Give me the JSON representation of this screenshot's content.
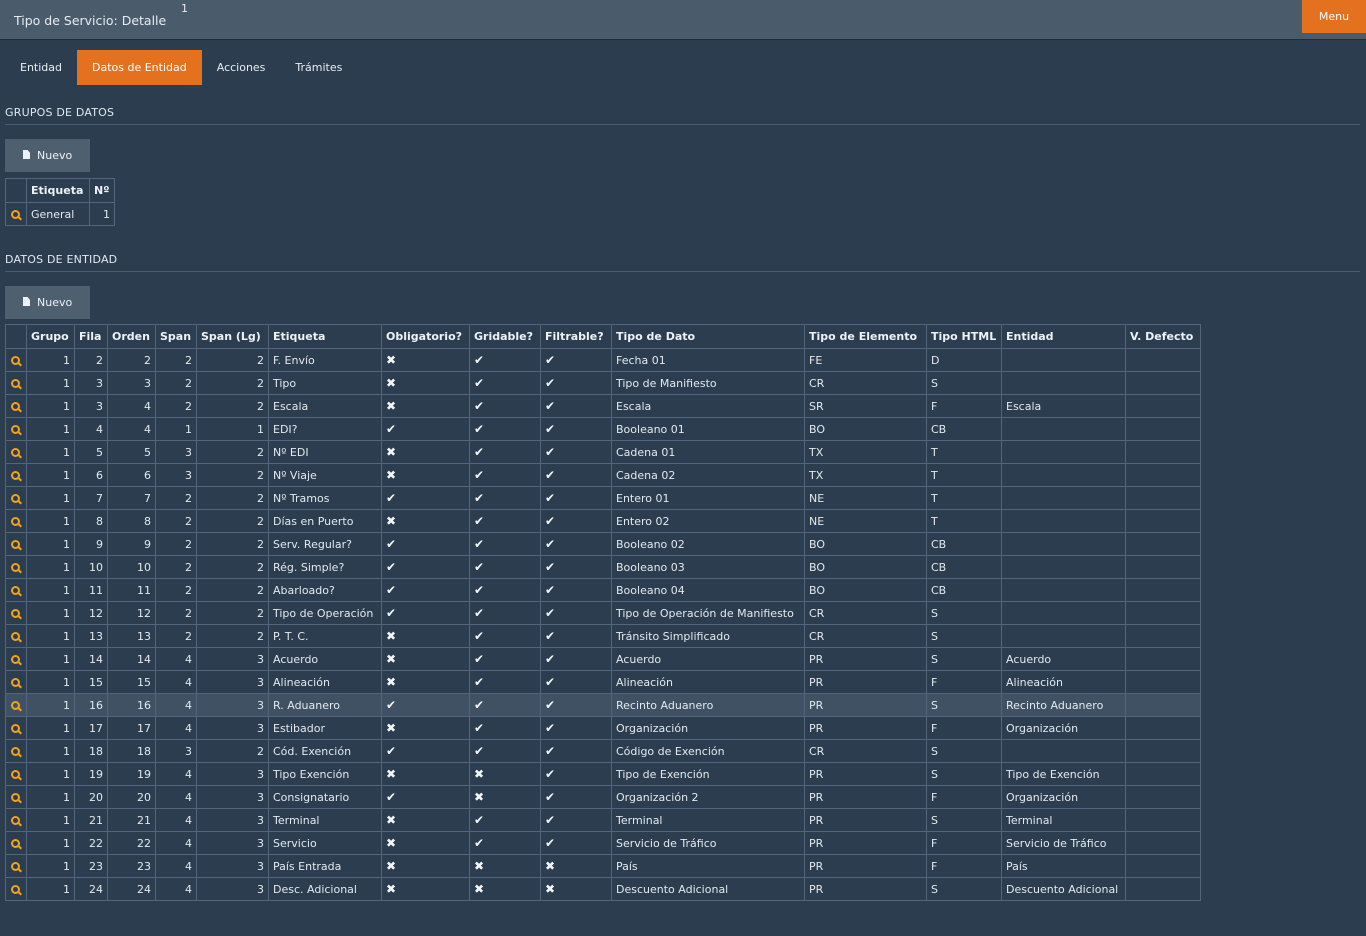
{
  "header": {
    "title": "Tipo de Servicio: Detalle",
    "counter": "1",
    "menu_label": "Menu"
  },
  "tabs": [
    {
      "label": "Entidad",
      "active": false
    },
    {
      "label": "Datos de Entidad",
      "active": true
    },
    {
      "label": "Acciones",
      "active": false
    },
    {
      "label": "Trámites",
      "active": false
    }
  ],
  "grupos": {
    "title": "GRUPOS DE DATOS",
    "new_label": "Nuevo",
    "columns": [
      "Etiqueta",
      "Nº"
    ],
    "rows": [
      {
        "etiqueta": "General",
        "n": "1"
      }
    ]
  },
  "datos": {
    "title": "DATOS DE ENTIDAD",
    "new_label": "Nuevo",
    "highlighted_row": 15,
    "columns": [
      "Grupo",
      "Fila",
      "Orden",
      "Span",
      "Span (Lg)",
      "Etiqueta",
      "Obligatorio?",
      "Gridable?",
      "Filtrable?",
      "Tipo de Dato",
      "Tipo de Elemento",
      "Tipo HTML",
      "Entidad",
      "V. Defecto"
    ],
    "rows": [
      {
        "grupo": "1",
        "fila": "2",
        "orden": "2",
        "span": "2",
        "span_lg": "2",
        "etiqueta": "F. Envío",
        "obligatorio": false,
        "gridable": true,
        "filtrable": true,
        "tipo_dato": "Fecha 01",
        "tipo_elemento": "FE",
        "tipo_html": "D",
        "entidad": "",
        "v_defecto": ""
      },
      {
        "grupo": "1",
        "fila": "3",
        "orden": "3",
        "span": "2",
        "span_lg": "2",
        "etiqueta": "Tipo",
        "obligatorio": false,
        "gridable": true,
        "filtrable": true,
        "tipo_dato": "Tipo de Manifiesto",
        "tipo_elemento": "CR",
        "tipo_html": "S",
        "entidad": "",
        "v_defecto": ""
      },
      {
        "grupo": "1",
        "fila": "3",
        "orden": "4",
        "span": "2",
        "span_lg": "2",
        "etiqueta": "Escala",
        "obligatorio": false,
        "gridable": true,
        "filtrable": true,
        "tipo_dato": "Escala",
        "tipo_elemento": "SR",
        "tipo_html": "F",
        "entidad": "Escala",
        "v_defecto": ""
      },
      {
        "grupo": "1",
        "fila": "4",
        "orden": "4",
        "span": "1",
        "span_lg": "1",
        "etiqueta": "EDI?",
        "obligatorio": true,
        "gridable": true,
        "filtrable": true,
        "tipo_dato": "Booleano 01",
        "tipo_elemento": "BO",
        "tipo_html": "CB",
        "entidad": "",
        "v_defecto": ""
      },
      {
        "grupo": "1",
        "fila": "5",
        "orden": "5",
        "span": "3",
        "span_lg": "2",
        "etiqueta": "Nº EDI",
        "obligatorio": false,
        "gridable": true,
        "filtrable": true,
        "tipo_dato": "Cadena 01",
        "tipo_elemento": "TX",
        "tipo_html": "T",
        "entidad": "",
        "v_defecto": ""
      },
      {
        "grupo": "1",
        "fila": "6",
        "orden": "6",
        "span": "3",
        "span_lg": "2",
        "etiqueta": "Nº Viaje",
        "obligatorio": false,
        "gridable": true,
        "filtrable": true,
        "tipo_dato": "Cadena 02",
        "tipo_elemento": "TX",
        "tipo_html": "T",
        "entidad": "",
        "v_defecto": ""
      },
      {
        "grupo": "1",
        "fila": "7",
        "orden": "7",
        "span": "2",
        "span_lg": "2",
        "etiqueta": "Nº Tramos",
        "obligatorio": true,
        "gridable": true,
        "filtrable": true,
        "tipo_dato": "Entero 01",
        "tipo_elemento": "NE",
        "tipo_html": "T",
        "entidad": "",
        "v_defecto": ""
      },
      {
        "grupo": "1",
        "fila": "8",
        "orden": "8",
        "span": "2",
        "span_lg": "2",
        "etiqueta": "Días en Puerto",
        "obligatorio": false,
        "gridable": true,
        "filtrable": true,
        "tipo_dato": "Entero 02",
        "tipo_elemento": "NE",
        "tipo_html": "T",
        "entidad": "",
        "v_defecto": ""
      },
      {
        "grupo": "1",
        "fila": "9",
        "orden": "9",
        "span": "2",
        "span_lg": "2",
        "etiqueta": "Serv. Regular?",
        "obligatorio": true,
        "gridable": true,
        "filtrable": true,
        "tipo_dato": "Booleano 02",
        "tipo_elemento": "BO",
        "tipo_html": "CB",
        "entidad": "",
        "v_defecto": ""
      },
      {
        "grupo": "1",
        "fila": "10",
        "orden": "10",
        "span": "2",
        "span_lg": "2",
        "etiqueta": "Rég. Simple?",
        "obligatorio": true,
        "gridable": true,
        "filtrable": true,
        "tipo_dato": "Booleano 03",
        "tipo_elemento": "BO",
        "tipo_html": "CB",
        "entidad": "",
        "v_defecto": ""
      },
      {
        "grupo": "1",
        "fila": "11",
        "orden": "11",
        "span": "2",
        "span_lg": "2",
        "etiqueta": "Abarloado?",
        "obligatorio": true,
        "gridable": true,
        "filtrable": true,
        "tipo_dato": "Booleano 04",
        "tipo_elemento": "BO",
        "tipo_html": "CB",
        "entidad": "",
        "v_defecto": ""
      },
      {
        "grupo": "1",
        "fila": "12",
        "orden": "12",
        "span": "2",
        "span_lg": "2",
        "etiqueta": "Tipo de Operación",
        "obligatorio": true,
        "gridable": true,
        "filtrable": true,
        "tipo_dato": "Tipo de Operación de Manifiesto",
        "tipo_elemento": "CR",
        "tipo_html": "S",
        "entidad": "",
        "v_defecto": ""
      },
      {
        "grupo": "1",
        "fila": "13",
        "orden": "13",
        "span": "2",
        "span_lg": "2",
        "etiqueta": "P. T. C.",
        "obligatorio": false,
        "gridable": true,
        "filtrable": true,
        "tipo_dato": "Tránsito Simplificado",
        "tipo_elemento": "CR",
        "tipo_html": "S",
        "entidad": "",
        "v_defecto": ""
      },
      {
        "grupo": "1",
        "fila": "14",
        "orden": "14",
        "span": "4",
        "span_lg": "3",
        "etiqueta": "Acuerdo",
        "obligatorio": false,
        "gridable": true,
        "filtrable": true,
        "tipo_dato": "Acuerdo",
        "tipo_elemento": "PR",
        "tipo_html": "S",
        "entidad": "Acuerdo",
        "v_defecto": ""
      },
      {
        "grupo": "1",
        "fila": "15",
        "orden": "15",
        "span": "4",
        "span_lg": "3",
        "etiqueta": "Alineación",
        "obligatorio": false,
        "gridable": true,
        "filtrable": true,
        "tipo_dato": "Alineación",
        "tipo_elemento": "PR",
        "tipo_html": "F",
        "entidad": "Alineación",
        "v_defecto": ""
      },
      {
        "grupo": "1",
        "fila": "16",
        "orden": "16",
        "span": "4",
        "span_lg": "3",
        "etiqueta": "R. Aduanero",
        "obligatorio": true,
        "gridable": true,
        "filtrable": true,
        "tipo_dato": "Recinto Aduanero",
        "tipo_elemento": "PR",
        "tipo_html": "S",
        "entidad": "Recinto Aduanero",
        "v_defecto": ""
      },
      {
        "grupo": "1",
        "fila": "17",
        "orden": "17",
        "span": "4",
        "span_lg": "3",
        "etiqueta": "Estibador",
        "obligatorio": false,
        "gridable": true,
        "filtrable": true,
        "tipo_dato": "Organización",
        "tipo_elemento": "PR",
        "tipo_html": "F",
        "entidad": "Organización",
        "v_defecto": ""
      },
      {
        "grupo": "1",
        "fila": "18",
        "orden": "18",
        "span": "3",
        "span_lg": "2",
        "etiqueta": "Cód. Exención",
        "obligatorio": true,
        "gridable": true,
        "filtrable": true,
        "tipo_dato": "Código de Exención",
        "tipo_elemento": "CR",
        "tipo_html": "S",
        "entidad": "",
        "v_defecto": ""
      },
      {
        "grupo": "1",
        "fila": "19",
        "orden": "19",
        "span": "4",
        "span_lg": "3",
        "etiqueta": "Tipo Exención",
        "obligatorio": false,
        "gridable": false,
        "filtrable": true,
        "tipo_dato": "Tipo de Exención",
        "tipo_elemento": "PR",
        "tipo_html": "S",
        "entidad": "Tipo de Exención",
        "v_defecto": ""
      },
      {
        "grupo": "1",
        "fila": "20",
        "orden": "20",
        "span": "4",
        "span_lg": "3",
        "etiqueta": "Consignatario",
        "obligatorio": true,
        "gridable": false,
        "filtrable": true,
        "tipo_dato": "Organización 2",
        "tipo_elemento": "PR",
        "tipo_html": "F",
        "entidad": "Organización",
        "v_defecto": ""
      },
      {
        "grupo": "1",
        "fila": "21",
        "orden": "21",
        "span": "4",
        "span_lg": "3",
        "etiqueta": "Terminal",
        "obligatorio": false,
        "gridable": true,
        "filtrable": true,
        "tipo_dato": "Terminal",
        "tipo_elemento": "PR",
        "tipo_html": "S",
        "entidad": "Terminal",
        "v_defecto": ""
      },
      {
        "grupo": "1",
        "fila": "22",
        "orden": "22",
        "span": "4",
        "span_lg": "3",
        "etiqueta": "Servicio",
        "obligatorio": false,
        "gridable": true,
        "filtrable": true,
        "tipo_dato": "Servicio de Tráfico",
        "tipo_elemento": "PR",
        "tipo_html": "F",
        "entidad": "Servicio de Tráfico",
        "v_defecto": ""
      },
      {
        "grupo": "1",
        "fila": "23",
        "orden": "23",
        "span": "4",
        "span_lg": "3",
        "etiqueta": "País Entrada",
        "obligatorio": false,
        "gridable": false,
        "filtrable": false,
        "tipo_dato": "País",
        "tipo_elemento": "PR",
        "tipo_html": "F",
        "entidad": "País",
        "v_defecto": ""
      },
      {
        "grupo": "1",
        "fila": "24",
        "orden": "24",
        "span": "4",
        "span_lg": "3",
        "etiqueta": "Desc. Adicional",
        "obligatorio": false,
        "gridable": false,
        "filtrable": false,
        "tipo_dato": "Descuento Adicional",
        "tipo_elemento": "PR",
        "tipo_html": "S",
        "entidad": "Descuento Adicional",
        "v_defecto": ""
      }
    ]
  },
  "icons": {
    "check": "✔",
    "cross": "✖",
    "row_action": "search-icon",
    "new_doc": "document-icon"
  },
  "colors": {
    "accent": "#e4711e",
    "background": "#2b3d4f",
    "topbar": "#4a5b6c",
    "icon": "#f2a21b"
  }
}
